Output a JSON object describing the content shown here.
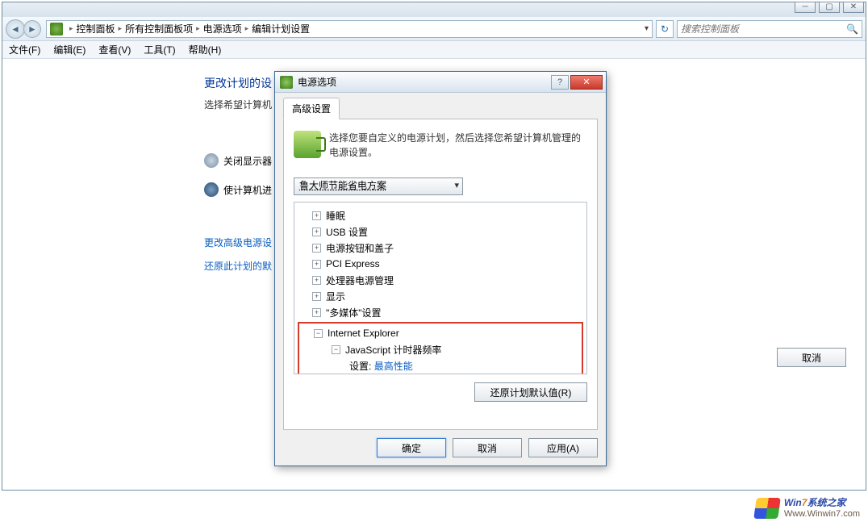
{
  "breadcrumb": {
    "root": "控制面板",
    "l2": "所有控制面板项",
    "l3": "电源选项",
    "l4": "编辑计划设置"
  },
  "search": {
    "placeholder": "搜索控制面板"
  },
  "menu": {
    "file": "文件(F)",
    "edit": "编辑(E)",
    "view": "查看(V)",
    "tools": "工具(T)",
    "help": "帮助(H)"
  },
  "page": {
    "title": "更改计划的设",
    "subtitle": "选择希望计算机",
    "row1": "关闭显示器",
    "row2": "使计算机进",
    "link1": "更改高级电源设",
    "link2": "还原此计划的默",
    "cancel": "取消"
  },
  "dialog": {
    "title": "电源选项",
    "tab": "高级设置",
    "desc": "选择您要自定义的电源计划，然后选择您希望计算机管理的电源设置。",
    "plan": "鲁大师节能省电方案",
    "tree": {
      "n0": "睡眠",
      "n1": "USB 设置",
      "n2": "电源按钮和盖子",
      "n3": "PCI Express",
      "n4": "处理器电源管理",
      "n5": "显示",
      "n6": "\"多媒体\"设置",
      "n7": "Internet Explorer",
      "n7a": "JavaScript 计时器频率",
      "n7b_label": "设置:",
      "n7b_value": "最高性能"
    },
    "restore": "还原计划默认值(R)",
    "ok": "确定",
    "cancel": "取消",
    "apply": "应用(A)"
  },
  "watermark": {
    "line1a": "Win",
    "line1b": "7",
    "line1c": "系统之家",
    "line2": "Www.Winwin7.com"
  }
}
